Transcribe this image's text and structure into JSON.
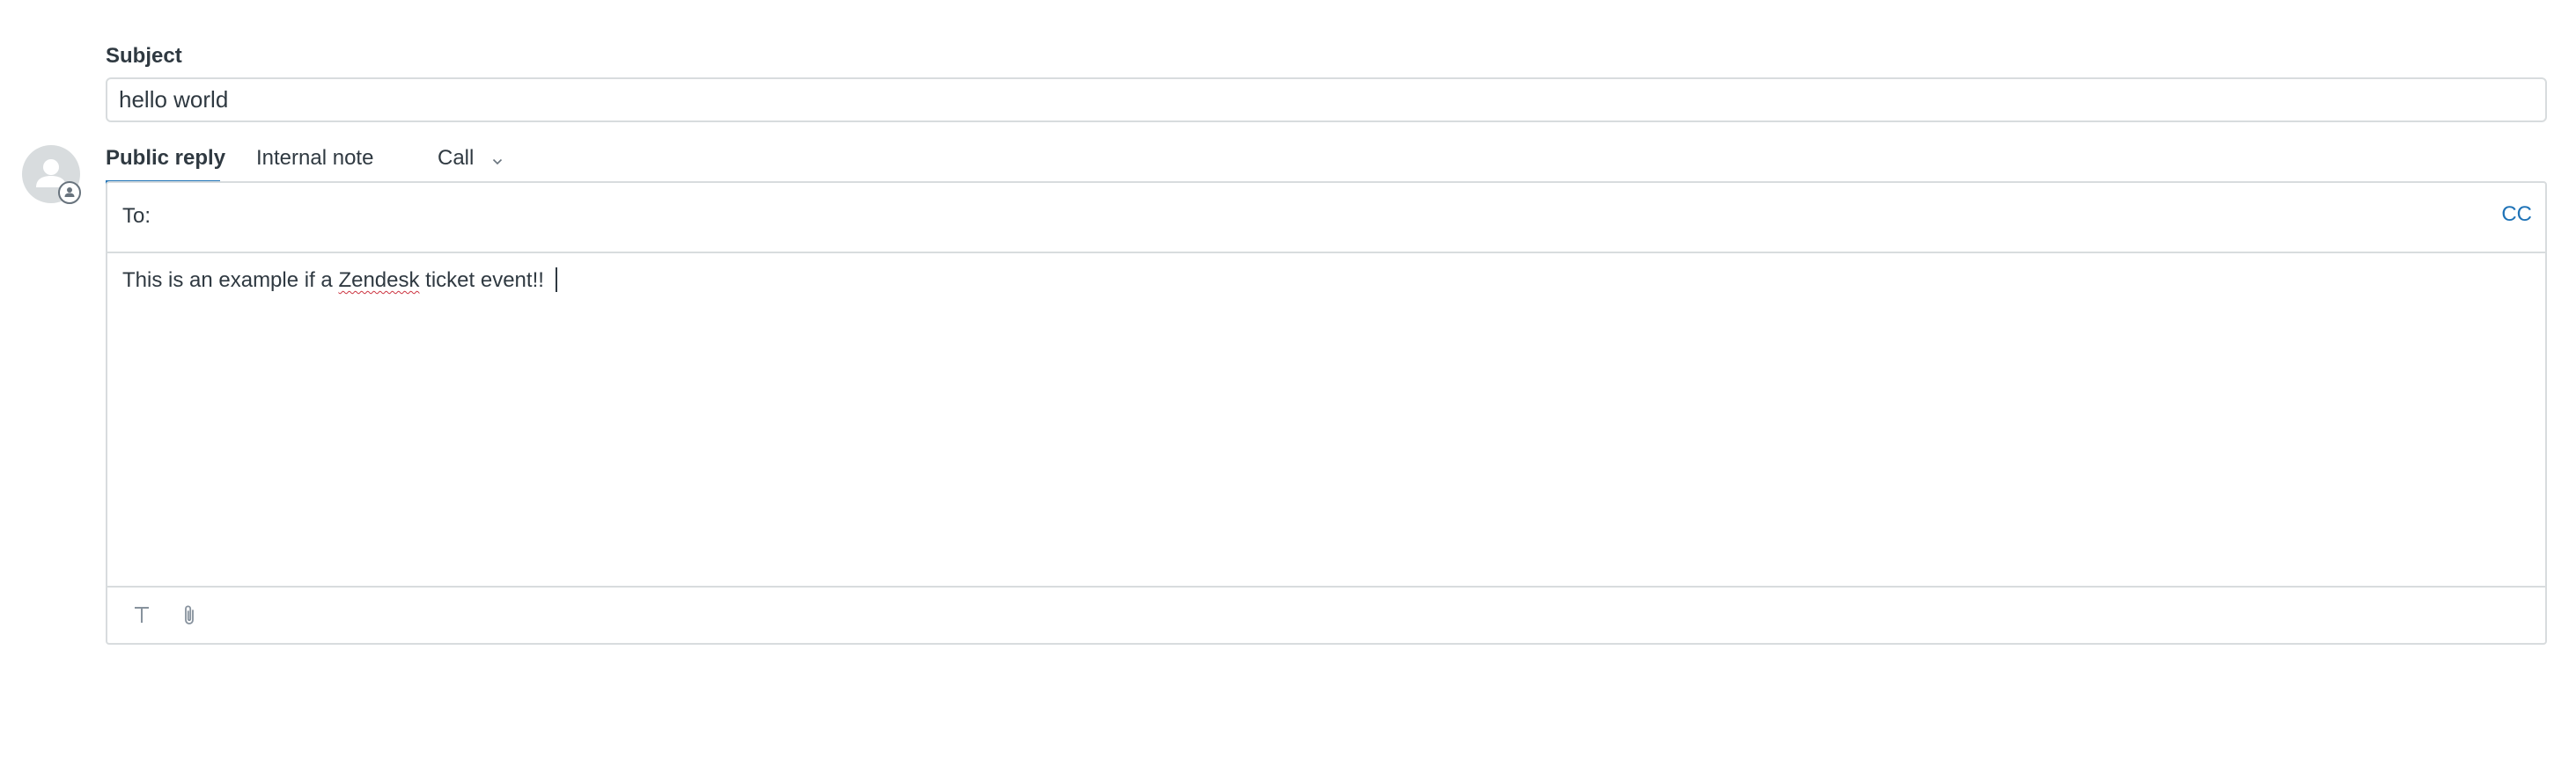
{
  "subject": {
    "label": "Subject",
    "value": "hello world"
  },
  "tabs": [
    {
      "label": "Public reply",
      "active": true
    },
    {
      "label": "Internal note",
      "active": false
    },
    {
      "label": "Call",
      "active": false
    }
  ],
  "composer": {
    "to_label": "To:",
    "cc_label": "CC",
    "body_before": "This is an example if a ",
    "body_misspelled": "Zendesk",
    "body_after": " ticket event!! "
  },
  "toolbar": {
    "icons": [
      "text-format-icon",
      "paperclip-icon"
    ]
  },
  "colors": {
    "accent": "#1f73b7",
    "text": "#2f3941",
    "border": "#d8dcde",
    "spellcheck": "#cc3340"
  }
}
